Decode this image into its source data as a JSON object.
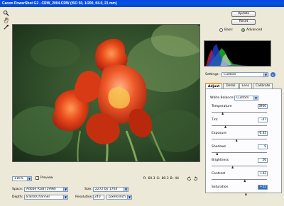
{
  "window": {
    "title": "Canon PowerShot G2 - CRW_2004.CRW (ISO 50, 1/200, f/4.0, 21 mm)"
  },
  "tools": [
    {
      "name": "zoom-tool-icon"
    },
    {
      "name": "hand-tool-icon"
    },
    {
      "name": "eyedropper-tool-icon"
    }
  ],
  "buttons": {
    "update": "Update",
    "reset": "Reset"
  },
  "mode": {
    "basic": "Basic",
    "advanced": "Advanced",
    "selected": "advanced"
  },
  "settings": {
    "label": "Settings:",
    "value": "Custom"
  },
  "tabs": [
    {
      "label": "Adjust",
      "active": true
    },
    {
      "label": "Detail",
      "active": false
    },
    {
      "label": "Lens",
      "active": false
    },
    {
      "label": "Calibrate",
      "active": false
    }
  ],
  "white_balance": {
    "label": "White Balance:",
    "value": "Custom"
  },
  "adjustments": [
    {
      "label": "Temperature",
      "value": "3900",
      "level": 0.2
    },
    {
      "label": "Tint",
      "value": "-47",
      "level": 0.25
    },
    {
      "label": "Exposure",
      "value": "-0.45",
      "level": 0.45
    },
    {
      "label": "Shadows",
      "value": "9",
      "level": 0.1
    },
    {
      "label": "Brightness",
      "value": "56",
      "level": 0.38
    },
    {
      "label": "Contrast",
      "value": "+42",
      "level": 0.6
    },
    {
      "label": "Saturation",
      "value": "+22",
      "level": 0.62,
      "selected": true
    }
  ],
  "zoom": {
    "value": "116%"
  },
  "preview_toggle": {
    "label": "Preview",
    "checked": true
  },
  "rgb_readout": {
    "r_label": "R:",
    "r": "60.3",
    "g_label": "G:",
    "g": "80.3",
    "b_label": "B:",
    "b": "44"
  },
  "bottom": {
    "space_label": "Space:",
    "space_value": "Adobe RGB (1998)",
    "depth_label": "Depth:",
    "depth_value": "8 Bits/Channel",
    "size_label": "Size:",
    "size_value": "2272 by 1704",
    "resolution_label": "Resolution:",
    "resolution_value": "240",
    "resolution_unit": "pixels/inch"
  },
  "colors": {
    "title_bar": "#0554e6",
    "tab_accent": "#f2a32a",
    "selection": "#316ac5"
  }
}
